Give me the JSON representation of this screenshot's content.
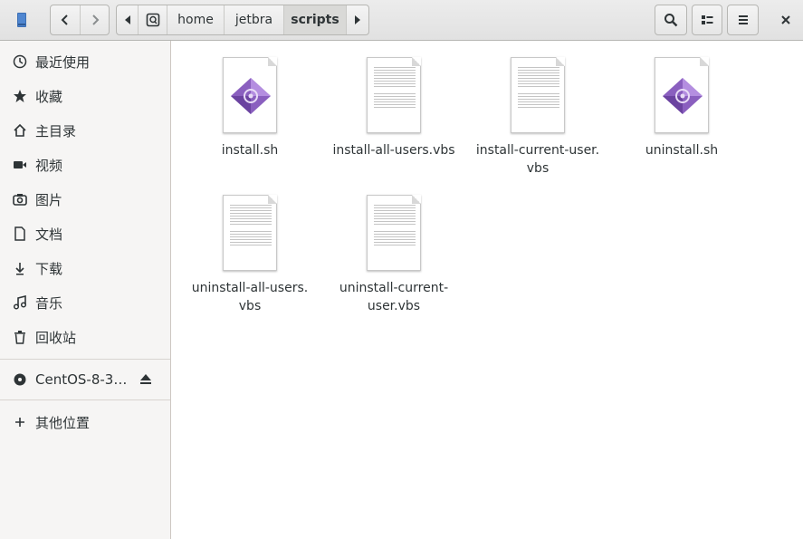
{
  "header": {
    "path": [
      "home",
      "jetbra",
      "scripts"
    ],
    "active_segment": "scripts"
  },
  "sidebar": {
    "items": [
      {
        "label": "最近使用",
        "icon": "recent-icon"
      },
      {
        "label": "收藏",
        "icon": "star-icon"
      },
      {
        "label": "主目录",
        "icon": "home-icon"
      },
      {
        "label": "视频",
        "icon": "video-icon"
      },
      {
        "label": "图片",
        "icon": "camera-icon"
      },
      {
        "label": "文档",
        "icon": "document-icon"
      },
      {
        "label": "下载",
        "icon": "download-icon"
      },
      {
        "label": "音乐",
        "icon": "music-icon"
      },
      {
        "label": "回收站",
        "icon": "trash-icon"
      }
    ],
    "device": {
      "label": "CentOS-8-3…",
      "icon": "disc-icon"
    },
    "other": {
      "label": "其他位置",
      "icon": "plus-icon"
    }
  },
  "files": [
    {
      "name_lines": [
        "install.sh"
      ],
      "type": "script"
    },
    {
      "name_lines": [
        "install-all-users.vbs"
      ],
      "type": "text"
    },
    {
      "name_lines": [
        "install-current-user.",
        "vbs"
      ],
      "type": "text"
    },
    {
      "name_lines": [
        "uninstall.sh"
      ],
      "type": "script"
    },
    {
      "name_lines": [
        "uninstall-all-users.",
        "vbs"
      ],
      "type": "text"
    },
    {
      "name_lines": [
        "uninstall-current-",
        "user.vbs"
      ],
      "type": "text"
    }
  ],
  "colors": {
    "script_icon": "#9b6fc9",
    "sidebar_bg": "#f6f5f4",
    "header_bg": "#e6e6e6"
  }
}
